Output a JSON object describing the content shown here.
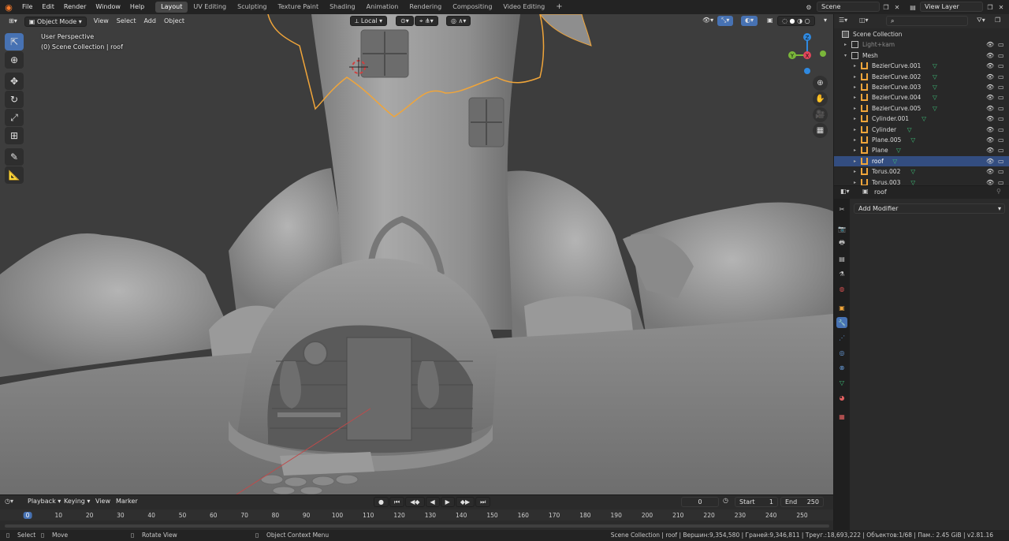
{
  "topbar": {
    "menus": [
      "File",
      "Edit",
      "Render",
      "Window",
      "Help"
    ],
    "workspaces": [
      "Layout",
      "UV Editing",
      "Sculpting",
      "Texture Paint",
      "Shading",
      "Animation",
      "Rendering",
      "Compositing",
      "Video Editing"
    ],
    "active_workspace": "Layout",
    "add_tab": "+",
    "scene_name": "Scene",
    "view_layer": "View Layer"
  },
  "viewport": {
    "mode": "Object Mode",
    "menus": [
      "View",
      "Select",
      "Add",
      "Object"
    ],
    "transform_orientation": "Local",
    "perspective_label": "User Perspective",
    "collection_label": "(0) Scene Collection | roof",
    "gizmo": {
      "x": "X",
      "y": "Y",
      "z": "Z"
    },
    "colors": {
      "x_axis": "#e2455a",
      "y_axis": "#7ab63a",
      "z_axis": "#2f89e0",
      "selection": "#f0a53a"
    }
  },
  "outliner": {
    "search_placeholder": "",
    "rows": [
      {
        "label": "Scene Collection",
        "type": "scene",
        "depth": 0
      },
      {
        "label": "Light+kam",
        "type": "collection",
        "depth": 1,
        "dim": true
      },
      {
        "label": "Mesh",
        "type": "collection",
        "depth": 1
      },
      {
        "label": "BezierCurve.001",
        "type": "curve",
        "depth": 2
      },
      {
        "label": "BezierCurve.002",
        "type": "curve",
        "depth": 2
      },
      {
        "label": "BezierCurve.003",
        "type": "curve",
        "depth": 2
      },
      {
        "label": "BezierCurve.004",
        "type": "curve",
        "depth": 2
      },
      {
        "label": "BezierCurve.005",
        "type": "curve",
        "depth": 2
      },
      {
        "label": "Cylinder.001",
        "type": "mesh",
        "depth": 2
      },
      {
        "label": "Cylinder",
        "type": "mesh",
        "depth": 2
      },
      {
        "label": "Plane.005",
        "type": "mesh",
        "depth": 2
      },
      {
        "label": "Plane",
        "type": "mesh",
        "depth": 2
      },
      {
        "label": "roof",
        "type": "mesh",
        "depth": 2,
        "selected": true
      },
      {
        "label": "Torus.002",
        "type": "mesh",
        "depth": 2
      },
      {
        "label": "Torus.003",
        "type": "mesh",
        "depth": 2
      }
    ]
  },
  "properties": {
    "object_name": "roof",
    "add_modifier": "Add Modifier"
  },
  "timeline": {
    "menus": [
      "Playback",
      "Keying",
      "View",
      "Marker"
    ],
    "current_frame": "0",
    "start_label": "Start",
    "start": "1",
    "end_label": "End",
    "end": "250",
    "ticks": [
      "0",
      "10",
      "20",
      "30",
      "40",
      "50",
      "60",
      "70",
      "80",
      "90",
      "100",
      "110",
      "120",
      "130",
      "140",
      "150",
      "160",
      "170",
      "180",
      "190",
      "200",
      "210",
      "220",
      "230",
      "240",
      "250"
    ]
  },
  "statusbar": {
    "select": "Select",
    "move": "Move",
    "rotate": "Rotate View",
    "context": "Object Context Menu",
    "stats": "Scene Collection | roof | Вершин:9,354,580 | Граней:9,346,811 | Треуг.:18,693,222 | Объектов:1/68 | Пам.: 2.45 GiB | v2.81.16"
  }
}
